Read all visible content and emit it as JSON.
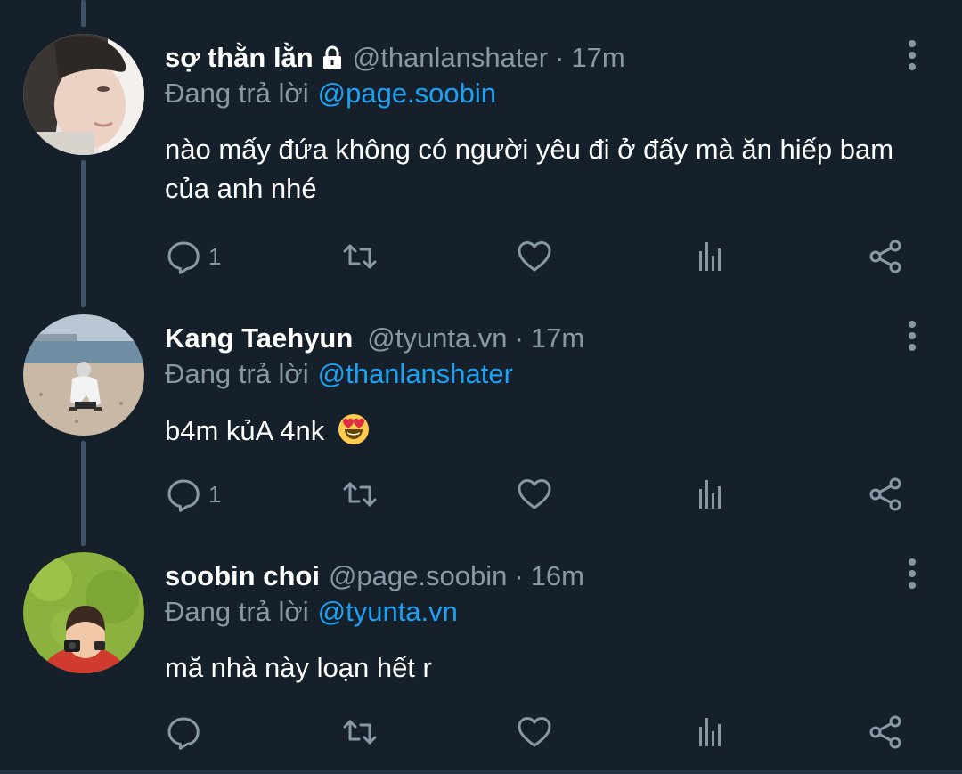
{
  "colors": {
    "background": "#15202b",
    "muted": "#8899a6",
    "accent": "#1da1f2",
    "text": "#ffffff"
  },
  "reply_prefix": "Đang trả lời",
  "tweets": [
    {
      "name": "sợ thằn lằn",
      "protected_icon": "lock-icon",
      "handle": "@thanlanshater",
      "separator": "·",
      "time": "17m",
      "reply_to": "@page.soobin",
      "text_line1": "nào mấy đứa không có người yêu đi ở đấy mà ăn hiếp bam",
      "text_line2": "của anh nhé",
      "reply_count": "1"
    },
    {
      "name": "Kang Taehyun",
      "handle": "@tyunta.vn",
      "separator": "·",
      "time": "17m",
      "reply_to": "@thanlanshater",
      "text": "b4m kủA 4nk",
      "emoji": "heart-eyes-emoji",
      "reply_count": "1"
    },
    {
      "name": "soobin choi",
      "handle": "@page.soobin",
      "separator": "·",
      "time": "16m",
      "reply_to": "@tyunta.vn",
      "text": "mă nhà này loạn hết r",
      "reply_count": ""
    }
  ],
  "action_icons": [
    "reply-icon",
    "retweet-icon",
    "like-icon",
    "analytics-icon",
    "share-icon"
  ]
}
